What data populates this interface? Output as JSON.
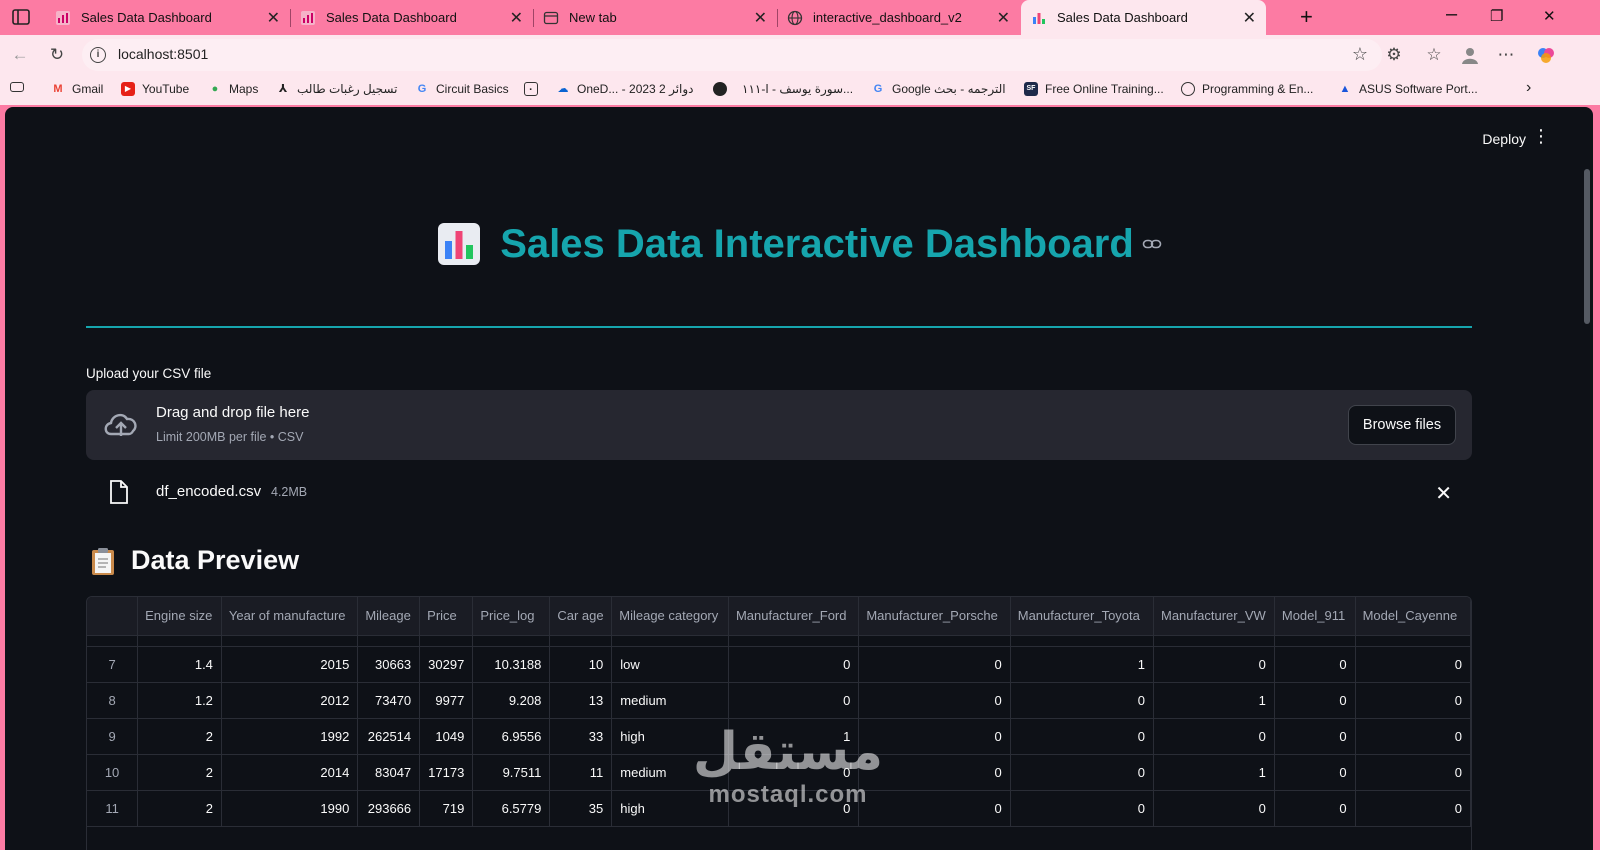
{
  "browser": {
    "tabs": [
      {
        "title": "Sales Data Dashboard",
        "favicon": "streamlit-chart-favicon"
      },
      {
        "title": "Sales Data Dashboard",
        "favicon": "streamlit-chart-favicon"
      },
      {
        "title": "New tab",
        "favicon": "newtab-favicon"
      },
      {
        "title": "interactive_dashboard_v2",
        "favicon": "globe-favicon"
      },
      {
        "title": "Sales Data Dashboard",
        "favicon": "bar-chart-favicon",
        "active": true
      }
    ],
    "url": "localhost:8501",
    "bookmarks": [
      {
        "label": "Gmail",
        "icon": "gmail-icon"
      },
      {
        "label": "YouTube",
        "icon": "youtube-icon"
      },
      {
        "label": "Maps",
        "icon": "maps-icon"
      },
      {
        "label": "تسجيل رغبات طالب",
        "icon": "tree-icon"
      },
      {
        "label": "Circuit Basics",
        "icon": "google-icon"
      },
      {
        "label": "",
        "icon": "calendar-icon"
      },
      {
        "label": "OneD... - 2023 دوائر 2",
        "icon": "onedrive-icon"
      },
      {
        "label": "",
        "icon": "dark-logo-icon"
      },
      {
        "label": "سورة يوسف - ا-١١١...",
        "icon": ""
      },
      {
        "label": "Google الترجمه - بحث",
        "icon": "google-icon"
      },
      {
        "label": "Free Online Training...",
        "icon": "sf-icon"
      },
      {
        "label": "Programming & En...",
        "icon": "globe-icon"
      },
      {
        "label": "ASUS Software Port...",
        "icon": "asus-icon"
      }
    ]
  },
  "app": {
    "deploy_label": "Deploy",
    "title": "Sales Data Interactive Dashboard",
    "accent_color": "#16a5ad",
    "uploader": {
      "label": "Upload your CSV file",
      "drop_text": "Drag and drop file here",
      "limit_text": "Limit 200MB per file • CSV",
      "browse_label": "Browse files"
    },
    "file": {
      "name": "df_encoded.csv",
      "size": "4.2MB"
    },
    "preview_heading": "Data Preview",
    "table": {
      "columns": [
        "Engine size",
        "Year of manufacture",
        "Mileage",
        "Price",
        "Price_log",
        "Car age",
        "Mileage category",
        "Manufacturer_Ford",
        "Manufacturer_Porsche",
        "Manufacturer_Toyota",
        "Manufacturer_VW",
        "Model_911",
        "Model_Cayenne"
      ],
      "rows": [
        {
          "index": "7",
          "cells": [
            "1.4",
            "2015",
            "30663",
            "30297",
            "10.3188",
            "10",
            "low",
            "0",
            "0",
            "1",
            "0",
            "0",
            "0"
          ]
        },
        {
          "index": "8",
          "cells": [
            "1.2",
            "2012",
            "73470",
            "9977",
            "9.208",
            "13",
            "medium",
            "0",
            "0",
            "0",
            "1",
            "0",
            "0"
          ]
        },
        {
          "index": "9",
          "cells": [
            "2",
            "1992",
            "262514",
            "1049",
            "6.9556",
            "33",
            "high",
            "1",
            "0",
            "0",
            "0",
            "0",
            "0"
          ]
        },
        {
          "index": "10",
          "cells": [
            "2",
            "2014",
            "83047",
            "17173",
            "9.7511",
            "11",
            "medium",
            "0",
            "0",
            "0",
            "1",
            "0",
            "0"
          ]
        },
        {
          "index": "11",
          "cells": [
            "2",
            "1990",
            "293666",
            "719",
            "6.5779",
            "35",
            "high",
            "0",
            "0",
            "0",
            "0",
            "0",
            "0"
          ]
        }
      ]
    },
    "watermark": {
      "arabic": "مستقل",
      "latin": "mostaql.com"
    }
  }
}
